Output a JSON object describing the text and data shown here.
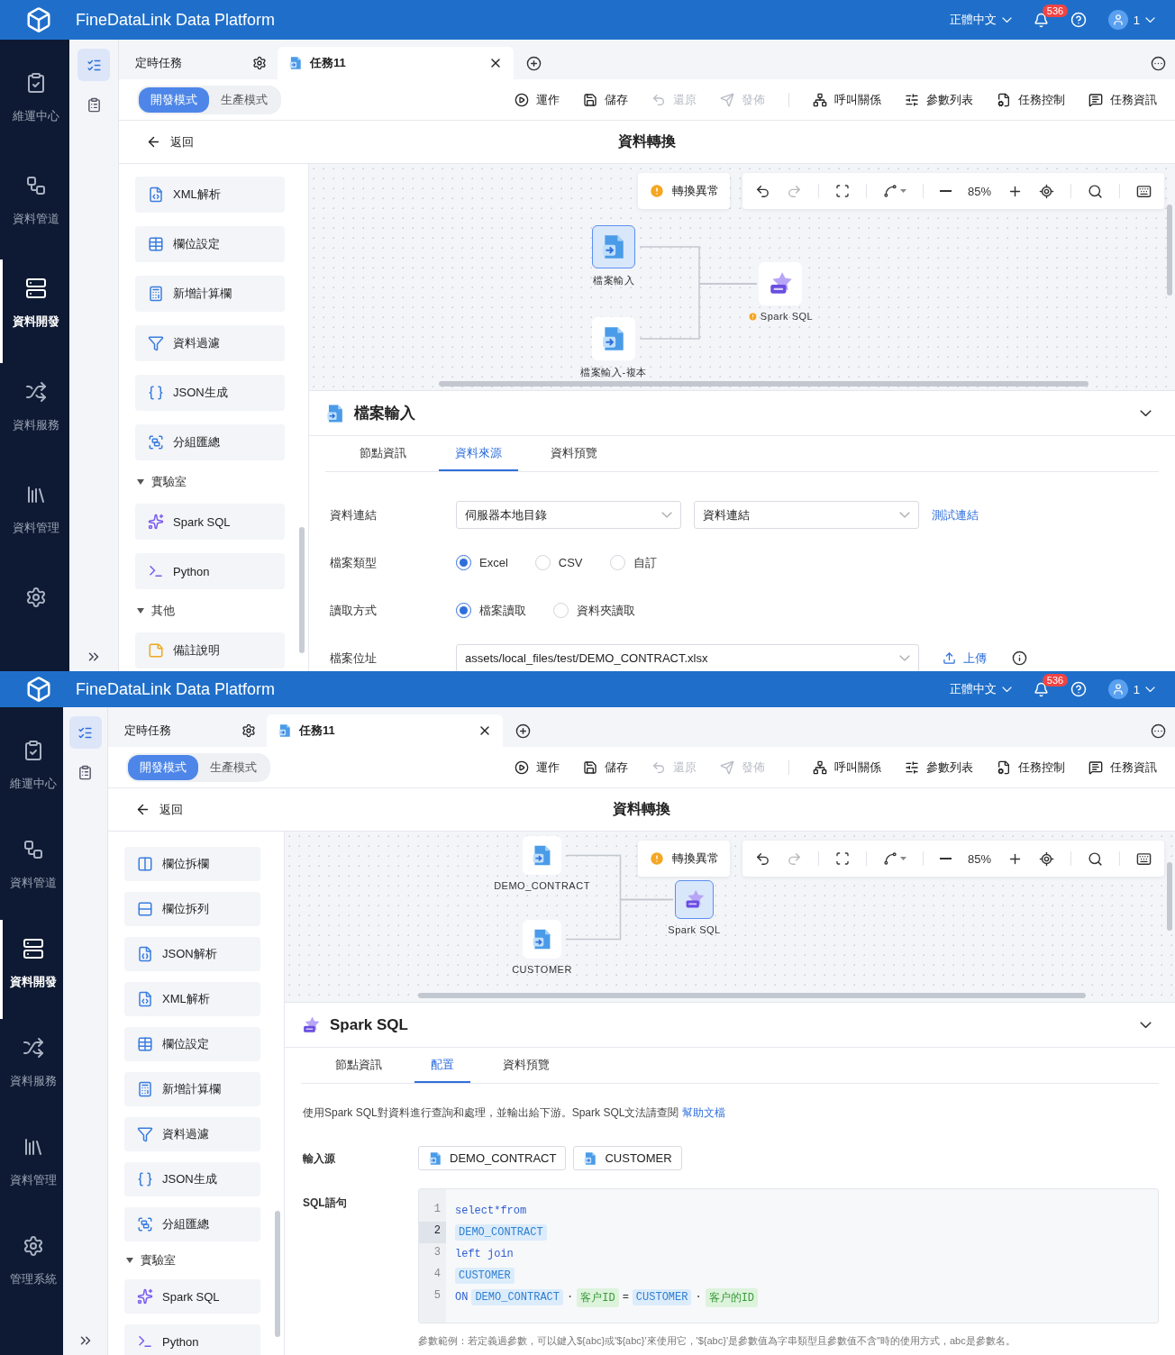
{
  "screens": [
    {
      "header": {
        "title": "FineDataLink Data Platform",
        "language": "正體中文",
        "notifications": "536",
        "user": "1"
      },
      "nav": [
        {
          "label": "維運中心",
          "kind": "ops",
          "selected": false
        },
        {
          "label": "資料管道",
          "kind": "pipe",
          "selected": false
        },
        {
          "label": "資料開發",
          "kind": "dev",
          "selected": true
        },
        {
          "label": "資料服務",
          "kind": "service",
          "selected": false
        },
        {
          "label": "資料管理",
          "kind": "manage",
          "selected": false
        },
        {
          "kind": "system",
          "selected": false
        }
      ],
      "rail": [
        {
          "kind": "tasks",
          "selected": true
        },
        {
          "kind": "clipboard",
          "selected": false
        }
      ],
      "tabs": [
        {
          "label": "定時任務",
          "kind": "folder",
          "selected": false
        },
        {
          "label": "任務11",
          "kind": "task",
          "selected": true
        }
      ],
      "modes": [
        {
          "label": "開發模式",
          "selected": true
        },
        {
          "label": "生產模式",
          "selected": false
        }
      ],
      "actions": [
        {
          "label": "運作",
          "kind": "run",
          "disabled": false,
          "separator_before": false
        },
        {
          "label": "儲存",
          "kind": "save",
          "disabled": false,
          "separator_before": false
        },
        {
          "label": "還原",
          "kind": "revert",
          "disabled": true,
          "separator_before": false
        },
        {
          "label": "發佈",
          "kind": "publish",
          "disabled": true,
          "separator_before": false
        },
        {
          "label": "呼叫關係",
          "kind": "calls",
          "disabled": false,
          "separator_before": true
        },
        {
          "label": "參數列表",
          "kind": "params",
          "disabled": false,
          "separator_before": false
        },
        {
          "label": "任務控制",
          "kind": "control",
          "disabled": false,
          "separator_before": false
        },
        {
          "label": "任務資訊",
          "kind": "info",
          "disabled": false,
          "separator_before": false
        }
      ],
      "back": "返回",
      "page_title": "資料轉換",
      "palette": [
        {
          "kind": "xml",
          "label": "XML解析"
        },
        {
          "kind": "fields",
          "label": "欄位設定"
        },
        {
          "kind": "calc",
          "label": "新增計算欄"
        },
        {
          "kind": "filter",
          "label": "資料過濾"
        },
        {
          "kind": "jsongen",
          "label": "JSON生成"
        },
        {
          "kind": "aggregate",
          "label": "分組匯總"
        },
        {
          "kind": "group",
          "label": "實驗室",
          "expanded": true,
          "children": [
            {
              "kind": "spark",
              "label": "Spark SQL"
            },
            {
              "kind": "python",
              "label": "Python"
            }
          ]
        },
        {
          "kind": "group",
          "label": "其他",
          "expanded": true,
          "children": [
            {
              "kind": "note",
              "label": "備註說明"
            }
          ]
        }
      ],
      "canvas": {
        "warning": "轉換異常",
        "zoom": "85%",
        "nodes": [
          {
            "label": "檔案輸入",
            "kind": "file",
            "selected": true,
            "warning": false
          },
          {
            "label": "檔案輸入-複本",
            "kind": "file",
            "selected": false,
            "warning": false
          },
          {
            "label": "Spark SQL",
            "kind": "sql",
            "selected": false,
            "warning": true
          }
        ]
      },
      "panel": {
        "kind": "form",
        "title": "檔案輸入",
        "tabs": [
          {
            "label": "節點資訊",
            "selected": false
          },
          {
            "label": "資料來源",
            "selected": true
          },
          {
            "label": "資料預覽",
            "selected": false
          }
        ],
        "rows": [
          {
            "label": "資料連結",
            "kind": "selects",
            "selects": [
              "伺服器本地目錄",
              "資料連結"
            ],
            "link": "測試連結"
          },
          {
            "label": "檔案類型",
            "kind": "radios",
            "options": [
              {
                "label": "Excel",
                "selected": true
              },
              {
                "label": "CSV",
                "selected": false
              },
              {
                "label": "自訂",
                "selected": false
              }
            ]
          },
          {
            "label": "讀取方式",
            "kind": "radios",
            "options": [
              {
                "label": "檔案讀取",
                "selected": true
              },
              {
                "label": "資料夾讀取",
                "selected": false
              }
            ]
          },
          {
            "label": "檔案位址",
            "kind": "path",
            "value": "assets/local_files/test/DEMO_CONTRACT.xlsx",
            "link": "上傳"
          }
        ]
      }
    },
    {
      "header": {
        "title": "FineDataLink Data Platform",
        "language": "正體中文",
        "notifications": "536",
        "user": "1"
      },
      "nav": [
        {
          "label": "維運中心",
          "kind": "ops",
          "selected": false
        },
        {
          "label": "資料管道",
          "kind": "pipe",
          "selected": false
        },
        {
          "label": "資料開發",
          "kind": "dev",
          "selected": true
        },
        {
          "label": "資料服務",
          "kind": "service",
          "selected": false
        },
        {
          "label": "資料管理",
          "kind": "manage",
          "selected": false
        },
        {
          "label": "管理系統",
          "kind": "system",
          "selected": false
        }
      ],
      "rail": [
        {
          "kind": "tasks",
          "selected": true
        },
        {
          "kind": "clipboard",
          "selected": false
        }
      ],
      "tabs": [
        {
          "label": "定時任務",
          "kind": "folder",
          "selected": false
        },
        {
          "label": "任務11",
          "kind": "task",
          "selected": true
        }
      ],
      "modes": [
        {
          "label": "開發模式",
          "selected": true
        },
        {
          "label": "生產模式",
          "selected": false
        }
      ],
      "actions": [
        {
          "label": "運作",
          "kind": "run",
          "disabled": false,
          "separator_before": false
        },
        {
          "label": "儲存",
          "kind": "save",
          "disabled": false,
          "separator_before": false
        },
        {
          "label": "還原",
          "kind": "revert",
          "disabled": true,
          "separator_before": false
        },
        {
          "label": "發佈",
          "kind": "publish",
          "disabled": true,
          "separator_before": false
        },
        {
          "label": "呼叫關係",
          "kind": "calls",
          "disabled": false,
          "separator_before": true
        },
        {
          "label": "參數列表",
          "kind": "params",
          "disabled": false,
          "separator_before": false
        },
        {
          "label": "任務控制",
          "kind": "control",
          "disabled": false,
          "separator_before": false
        },
        {
          "label": "任務資訊",
          "kind": "info",
          "disabled": false,
          "separator_before": false
        }
      ],
      "back": "返回",
      "page_title": "資料轉換",
      "palette": [
        {
          "kind": "splitcol",
          "label": "欄位拆欄"
        },
        {
          "kind": "splitrow",
          "label": "欄位拆列"
        },
        {
          "kind": "jsonparse",
          "label": "JSON解析"
        },
        {
          "kind": "xml",
          "label": "XML解析"
        },
        {
          "kind": "fields",
          "label": "欄位設定"
        },
        {
          "kind": "calc",
          "label": "新增計算欄"
        },
        {
          "kind": "filter",
          "label": "資料過濾"
        },
        {
          "kind": "jsongen",
          "label": "JSON生成"
        },
        {
          "kind": "aggregate",
          "label": "分組匯總"
        },
        {
          "kind": "group",
          "label": "實驗室",
          "expanded": true,
          "children": [
            {
              "kind": "spark",
              "label": "Spark SQL"
            },
            {
              "kind": "python",
              "label": "Python"
            }
          ]
        }
      ],
      "canvas": {
        "warning": "轉換異常",
        "zoom": "85%",
        "nodes": [
          {
            "label": "DEMO_CONTRACT",
            "kind": "file",
            "selected": false,
            "warning": false
          },
          {
            "label": "CUSTOMER",
            "kind": "file",
            "selected": false,
            "warning": false
          },
          {
            "label": "Spark SQL",
            "kind": "sql",
            "selected": true,
            "warning": false
          }
        ]
      },
      "panel": {
        "kind": "sql",
        "title": "Spark SQL",
        "tabs": [
          {
            "label": "節點資訊",
            "selected": false
          },
          {
            "label": "配置",
            "selected": true
          },
          {
            "label": "資料預覽",
            "selected": false
          }
        ],
        "description": "使用Spark SQL對資料進行查詢和處理，並輸出給下游。Spark SQL文法請查閱",
        "help_link": "幫助文檔",
        "sources_label": "輸入源",
        "sources": [
          "DEMO_CONTRACT",
          "CUSTOMER"
        ],
        "sql_label": "SQL語句",
        "lines": [
          {
            "number": "1",
            "selected": false,
            "tokens": [
              {
                "text": "select*from",
                "kind": "keyword"
              }
            ]
          },
          {
            "number": "2",
            "selected": true,
            "tokens": [
              {
                "text": "DEMO_CONTRACT",
                "kind": "table"
              }
            ]
          },
          {
            "number": "3",
            "selected": false,
            "tokens": [
              {
                "text": "left join",
                "kind": "keyword"
              }
            ]
          },
          {
            "number": "4",
            "selected": false,
            "tokens": [
              {
                "text": "CUSTOMER",
                "kind": "table"
              }
            ]
          },
          {
            "number": "5",
            "selected": false,
            "tokens": [
              {
                "text": "ON",
                "kind": "keyword"
              },
              {
                "text": "DEMO_CONTRACT",
                "kind": "table"
              },
              {
                "text": "·",
                "kind": "op"
              },
              {
                "text": "客户ID",
                "kind": "field"
              },
              {
                "text": "=",
                "kind": "op"
              },
              {
                "text": "CUSTOMER",
                "kind": "table"
              },
              {
                "text": "·",
                "kind": "op"
              },
              {
                "text": "客户的ID",
                "kind": "field"
              }
            ]
          }
        ],
        "hint": "參數範例：若定義過參數，可以鍵入${abc}或'${abc}'來使用它，'${abc}'是參數值為字串類型且參數值不含\"時的使用方式，abc是參數名。"
      }
    }
  ]
}
